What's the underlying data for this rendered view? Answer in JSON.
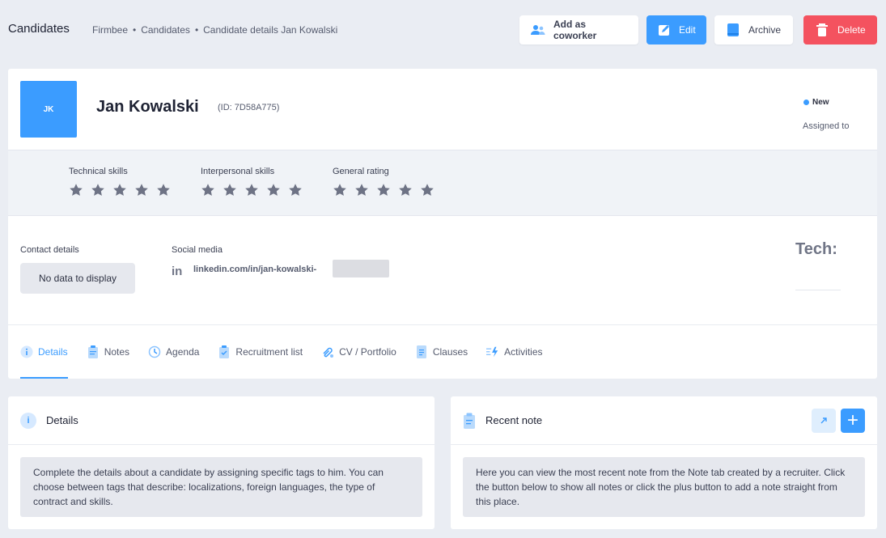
{
  "header": {
    "title": "Candidates",
    "breadcrumbs": [
      "Firmbee",
      "Candidates",
      "Candidate details Jan Kowalski"
    ],
    "breadcrumb_separator": "•",
    "buttons": {
      "add_coworker": "Add as coworker",
      "edit": "Edit",
      "archive": "Archive",
      "delete": "Delete"
    }
  },
  "candidate": {
    "initials": "JK",
    "name": "Jan Kowalski",
    "id_text": "(ID: 7D58A775)",
    "status": "New",
    "assigned_label": "Assigned to"
  },
  "skills": {
    "technical": {
      "label": "Technical skills",
      "stars_filled": 0,
      "stars_total": 5
    },
    "interpersonal": {
      "label": "Interpersonal skills",
      "stars_filled": 0,
      "stars_total": 5
    },
    "general": {
      "label": "General rating",
      "stars_filled": 0,
      "stars_total": 5
    }
  },
  "contact": {
    "label": "Contact details",
    "empty_text": "No data to display"
  },
  "social": {
    "label": "Social media",
    "icon": "in",
    "link": "linkedin.com/in/jan-kowalski-"
  },
  "tech_label": "Tech:",
  "tabs": [
    {
      "label": "Details",
      "icon": "info-icon"
    },
    {
      "label": "Notes",
      "icon": "clipboard-icon"
    },
    {
      "label": "Agenda",
      "icon": "clock-icon"
    },
    {
      "label": "Recruitment list",
      "icon": "checklist-icon"
    },
    {
      "label": "CV / Portfolio",
      "icon": "attachment-icon"
    },
    {
      "label": "Clauses",
      "icon": "document-icon"
    },
    {
      "label": "Activities",
      "icon": "activity-icon"
    }
  ],
  "details_panel": {
    "title": "Details",
    "icon_glyph": "i",
    "text": "Complete the details about a candidate by assigning specific tags to him. You can choose between tags that describe: localizations, foreign languages, the type of contract and skills."
  },
  "note_panel": {
    "title": "Recent note",
    "plus_glyph": "+",
    "text": "Here you can view the most recent note from the Note tab created by a recruiter. Click the button below to show all notes or click the plus button to add a note straight from this place."
  },
  "colors": {
    "accent": "#3b9cff",
    "danger": "#f4525f",
    "star": "#6e7385"
  }
}
